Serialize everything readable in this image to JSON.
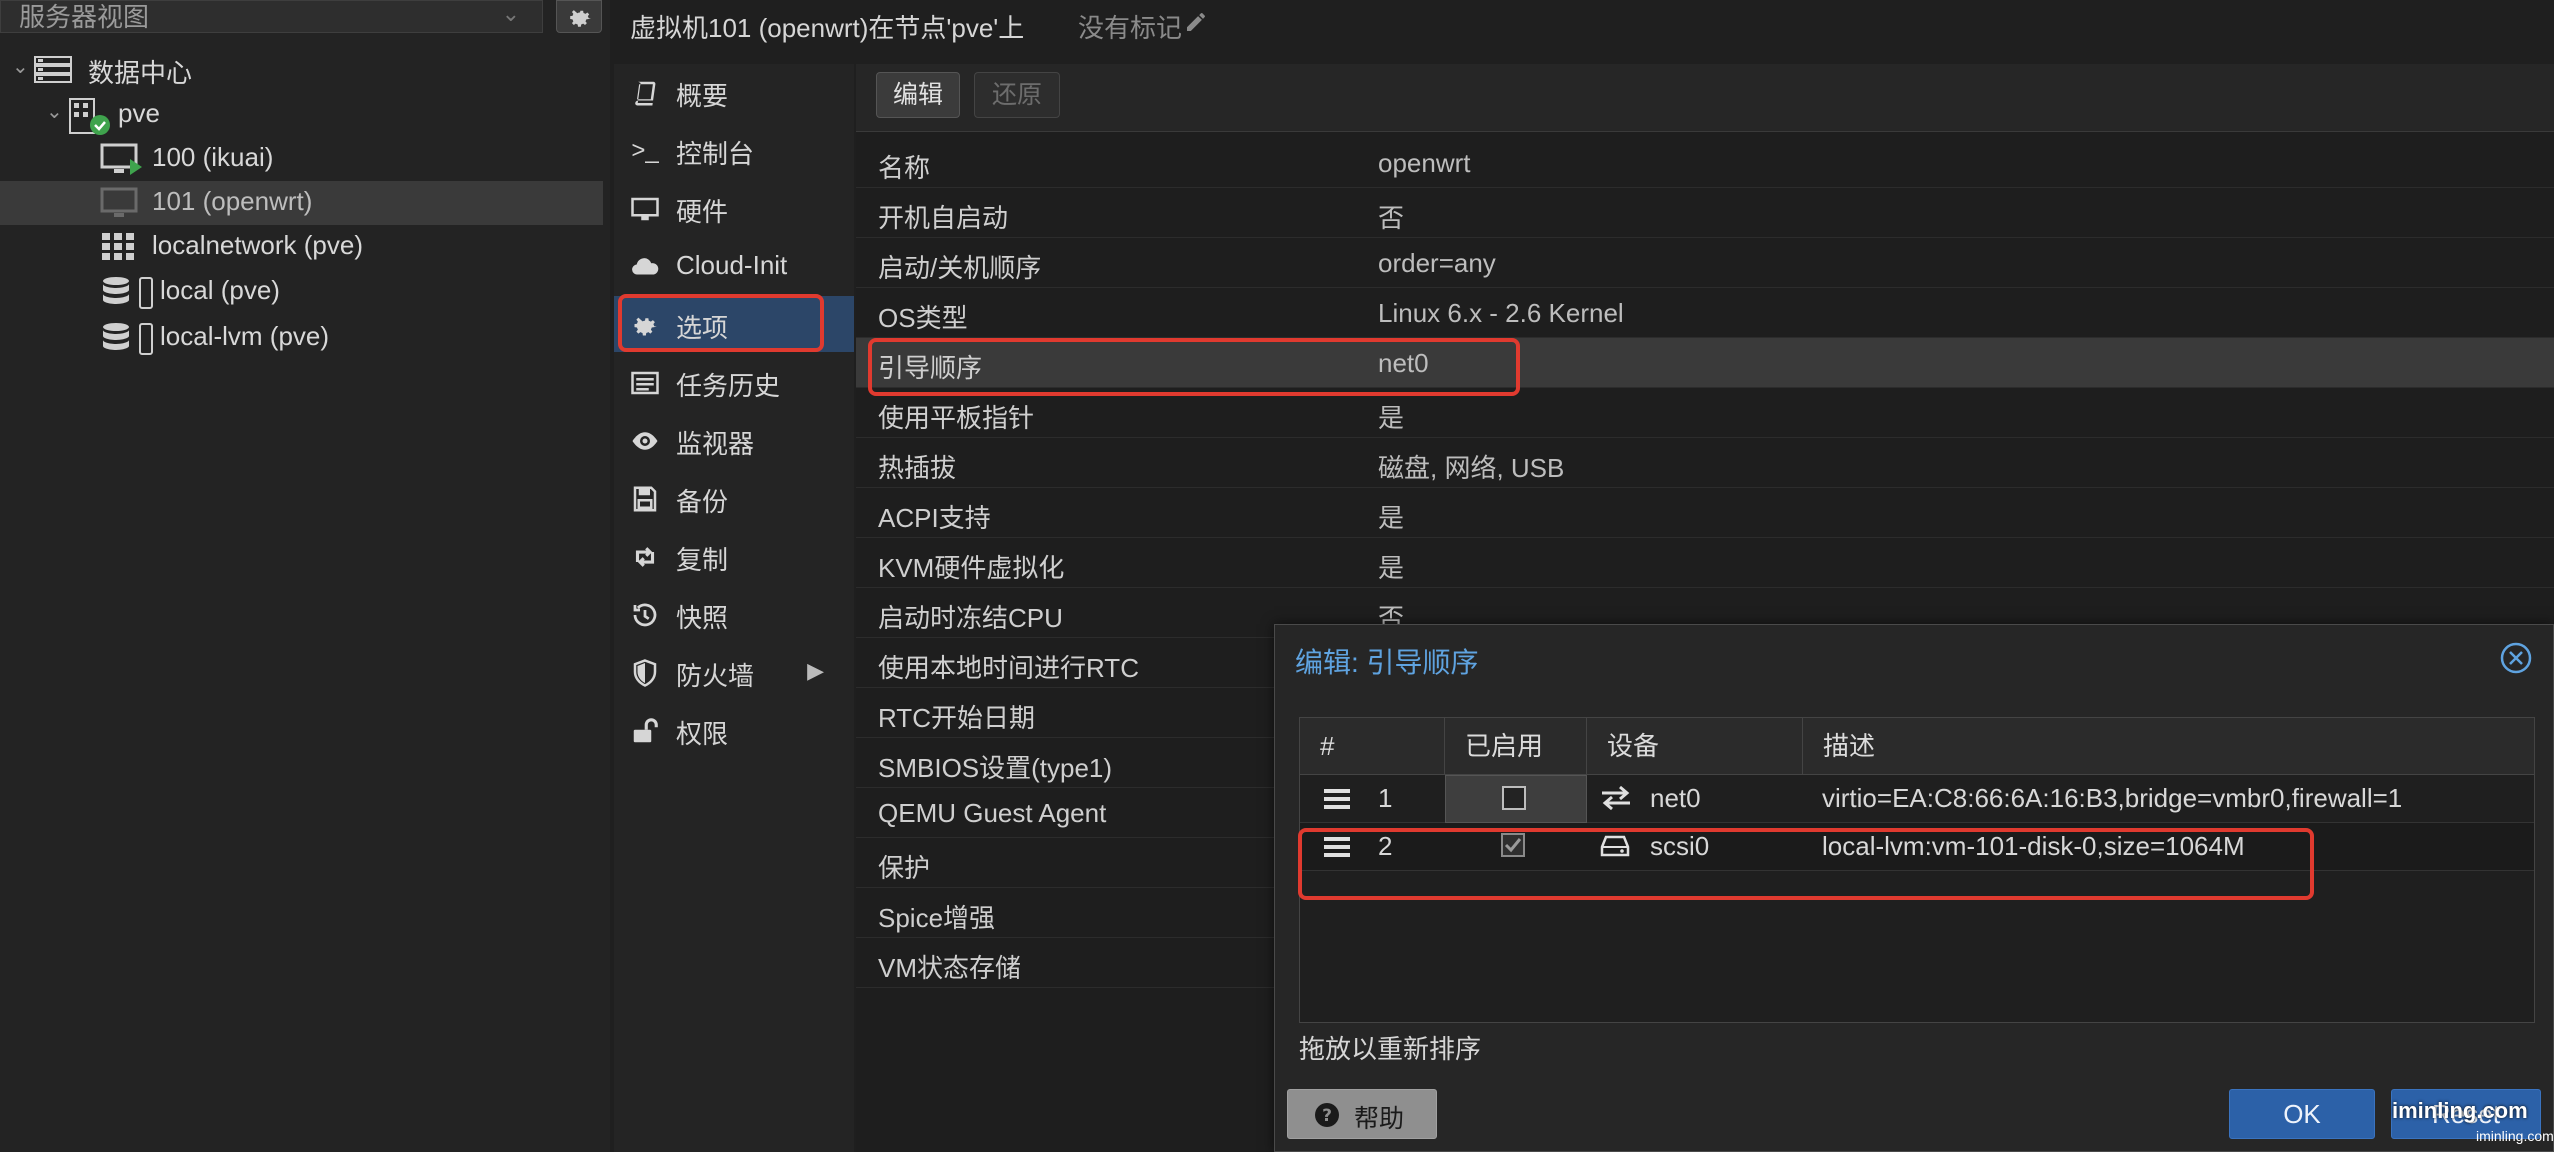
{
  "left_panel": {
    "view_label": "服务器视图",
    "tree": [
      {
        "label": "数据中心"
      },
      {
        "label": "pve"
      },
      {
        "label": "100 (ikuai)"
      },
      {
        "label": "101 (openwrt)"
      },
      {
        "label": "localnetwork (pve)"
      },
      {
        "label": "local (pve)"
      },
      {
        "label": "local-lvm (pve)"
      }
    ]
  },
  "header": {
    "title": "虚拟机101 (openwrt)在节点'pve'上",
    "tags_placeholder": "没有标记"
  },
  "nav": {
    "items": [
      {
        "label": "概要",
        "icon": "book-icon"
      },
      {
        "label": "控制台",
        "icon": "terminal-icon"
      },
      {
        "label": "硬件",
        "icon": "monitor-icon"
      },
      {
        "label": "Cloud-Init",
        "icon": "cloud-icon"
      },
      {
        "label": "选项",
        "icon": "gear-icon"
      },
      {
        "label": "任务历史",
        "icon": "list-icon"
      },
      {
        "label": "监视器",
        "icon": "eye-icon"
      },
      {
        "label": "备份",
        "icon": "floppy-icon"
      },
      {
        "label": "复制",
        "icon": "retweet-icon"
      },
      {
        "label": "快照",
        "icon": "history-icon"
      },
      {
        "label": "防火墙",
        "icon": "shield-icon"
      },
      {
        "label": "权限",
        "icon": "unlock-icon"
      }
    ],
    "selected": "选项"
  },
  "toolbar": {
    "edit_label": "编辑",
    "revert_label": "还原"
  },
  "options": [
    {
      "key": "名称",
      "value": "openwrt"
    },
    {
      "key": "开机自启动",
      "value": "否"
    },
    {
      "key": "启动/关机顺序",
      "value": "order=any"
    },
    {
      "key": "OS类型",
      "value": "Linux 6.x - 2.6 Kernel"
    },
    {
      "key": "引导顺序",
      "value": "net0"
    },
    {
      "key": "使用平板指针",
      "value": "是"
    },
    {
      "key": "热插拔",
      "value": "磁盘, 网络, USB"
    },
    {
      "key": "ACPI支持",
      "value": "是"
    },
    {
      "key": "KVM硬件虚拟化",
      "value": "是"
    },
    {
      "key": "启动时冻结CPU",
      "value": "否"
    },
    {
      "key": "使用本地时间进行RTC",
      "value": ""
    },
    {
      "key": "RTC开始日期",
      "value": ""
    },
    {
      "key": "SMBIOS设置(type1)",
      "value": ""
    },
    {
      "key": "QEMU Guest Agent",
      "value": ""
    },
    {
      "key": "保护",
      "value": ""
    },
    {
      "key": "Spice增强",
      "value": ""
    },
    {
      "key": "VM状态存储",
      "value": ""
    }
  ],
  "dialog": {
    "title": "编辑: 引导顺序",
    "columns": [
      "#",
      "已启用",
      "设备",
      "描述"
    ],
    "rows": [
      {
        "num": "1",
        "enabled": false,
        "device": "net0",
        "description": "virtio=EA:C8:66:6A:16:B3,bridge=vmbr0,firewall=1"
      },
      {
        "num": "2",
        "enabled": true,
        "device": "scsi0",
        "description": "local-lvm:vm-101-disk-0,size=1064M"
      }
    ],
    "hint": "拖放以重新排序",
    "help_label": "帮助",
    "ok_label": "OK",
    "reset_label": "Reset"
  },
  "watermark": {
    "text": "iminling.com",
    "sub": "iminling.com"
  },
  "colors": {
    "accent_blue": "#2c61a8",
    "title_blue": "#5fa3e0",
    "annotation_red": "#e03a2f",
    "selected_nav": "#2c4668",
    "running_green": "#3fa34d"
  }
}
